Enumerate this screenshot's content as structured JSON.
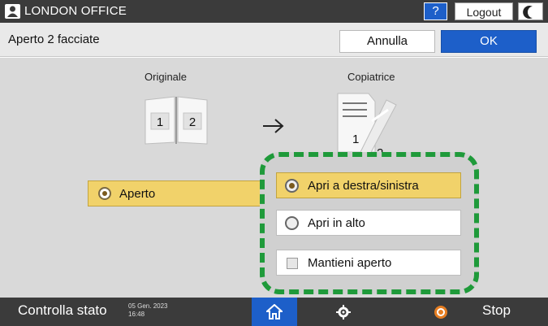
{
  "header": {
    "title": "LONDON OFFICE",
    "help_label": "?",
    "logout_label": "Logout"
  },
  "subheader": {
    "page_title": "Aperto 2 facciate",
    "cancel_label": "Annulla",
    "ok_label": "OK"
  },
  "main": {
    "original_label": "Originale",
    "copier_label": "Copiatrice",
    "book_pages": [
      "1",
      "2"
    ],
    "copy_pages": [
      "1",
      "2"
    ],
    "aperto_label": "Aperto"
  },
  "popup": {
    "options": [
      {
        "label": "Apri a destra/sinistra",
        "selected": true
      },
      {
        "label": "Apri in alto",
        "selected": false
      }
    ],
    "keep_open_label": "Mantieni aperto"
  },
  "footer": {
    "status_label": "Controlla stato",
    "date": "05 Gen. 2023",
    "time": "16:48",
    "stop_label": "Stop"
  },
  "colors": {
    "accent_blue": "#1d5fc9",
    "selected_yellow": "#f1d26a",
    "dashed_green": "#1f9a3a",
    "bar_dark": "#3b3b3b"
  }
}
